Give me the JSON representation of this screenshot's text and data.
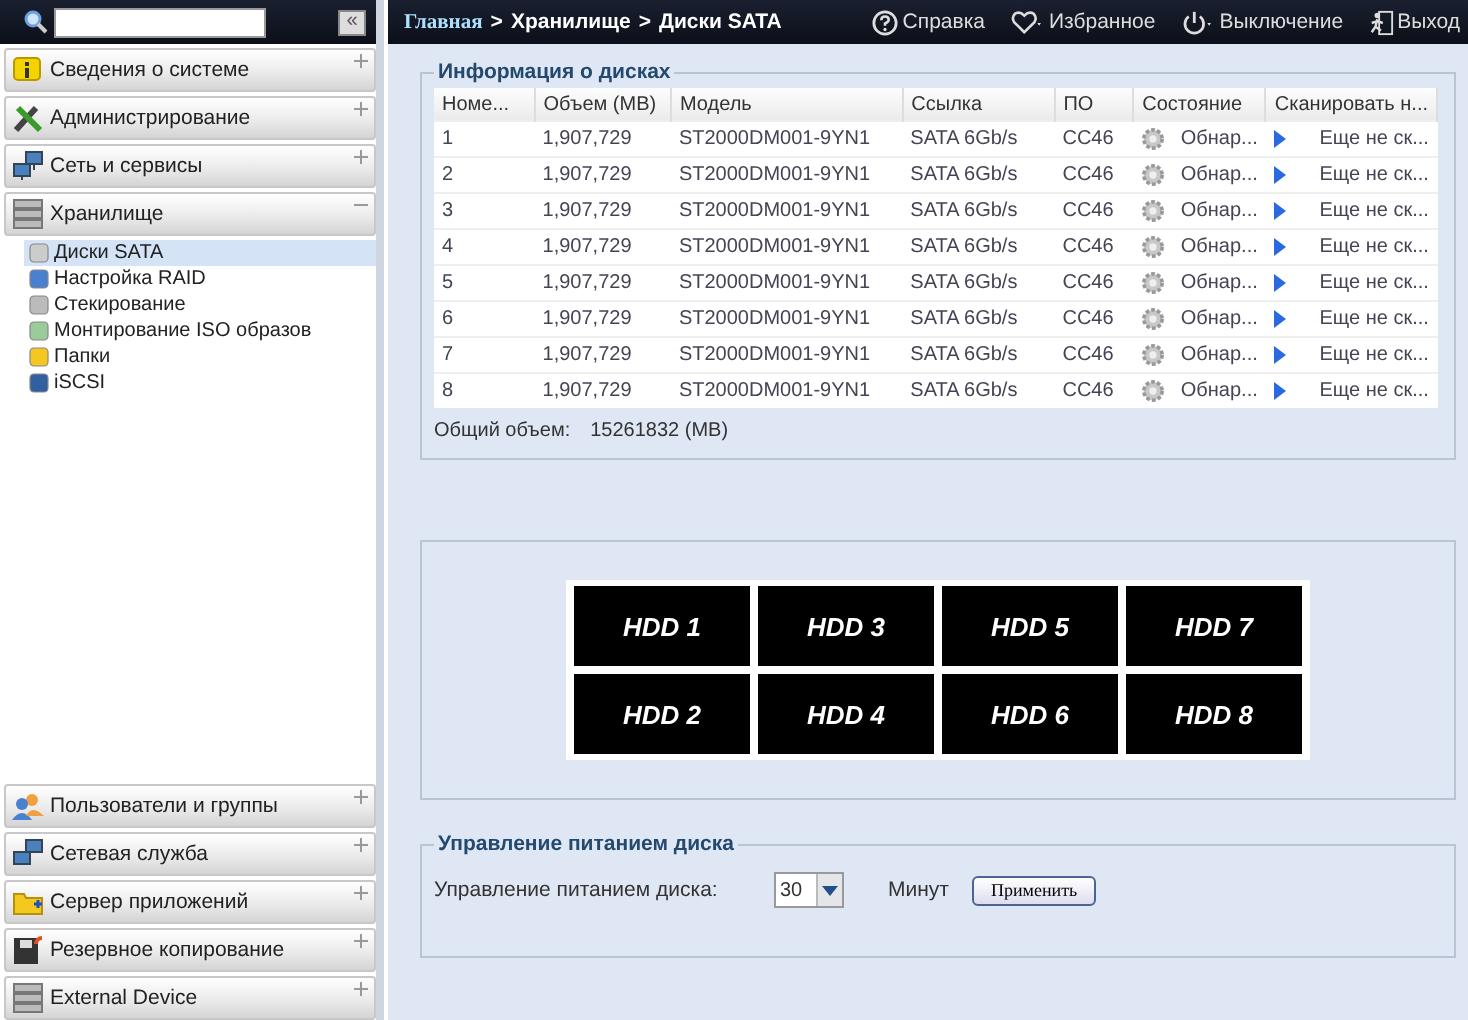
{
  "sidebar": {
    "collapse_button": "«",
    "sections": [
      {
        "label": "Сведения о системе",
        "expanded": false
      },
      {
        "label": "Администрирование",
        "expanded": false
      },
      {
        "label": "Сеть и сервисы",
        "expanded": false
      },
      {
        "label": "Хранилище",
        "expanded": true,
        "children": [
          {
            "label": "Диски SATA",
            "selected": true
          },
          {
            "label": "Настройка RAID",
            "selected": false
          },
          {
            "label": "Стекирование",
            "selected": false
          },
          {
            "label": "Монтирование ISO образов",
            "selected": false
          },
          {
            "label": "Папки",
            "selected": false
          },
          {
            "label": "iSCSI",
            "selected": false
          }
        ]
      }
    ],
    "bottom_sections": [
      {
        "label": "Пользователи и группы",
        "expanded": false
      },
      {
        "label": "Сетевая служба",
        "expanded": false
      },
      {
        "label": "Сервер приложений",
        "expanded": false
      },
      {
        "label": "Резервное копирование",
        "expanded": false
      },
      {
        "label": "External Device",
        "expanded": false
      }
    ]
  },
  "header": {
    "breadcrumb": [
      {
        "label": "Главная",
        "kind": "link"
      },
      {
        "label": ">",
        "kind": "separator"
      },
      {
        "label": "Хранилище",
        "kind": "text"
      },
      {
        "label": ">",
        "kind": "separator"
      },
      {
        "label": "Диски SATA",
        "kind": "text"
      }
    ],
    "actions": [
      "Справка",
      "Избранное",
      "Выключение",
      "Выход"
    ]
  },
  "disk_info": {
    "title": "Информация о дисках",
    "columns": [
      "Номе...",
      "Объем (MB)",
      "Модель",
      "Ссылка",
      "ПО",
      "Состояние",
      "Сканировать н..."
    ],
    "rows": [
      [
        "1",
        "1,907,729",
        "ST2000DM001-9YN1",
        "SATA 6Gb/s",
        "CC46",
        "Обнар...",
        "Еще не ск..."
      ],
      [
        "2",
        "1,907,729",
        "ST2000DM001-9YN1",
        "SATA 6Gb/s",
        "CC46",
        "Обнар...",
        "Еще не ск..."
      ],
      [
        "3",
        "1,907,729",
        "ST2000DM001-9YN1",
        "SATA 6Gb/s",
        "CC46",
        "Обнар...",
        "Еще не ск..."
      ],
      [
        "4",
        "1,907,729",
        "ST2000DM001-9YN1",
        "SATA 6Gb/s",
        "CC46",
        "Обнар...",
        "Еще не ск..."
      ],
      [
        "5",
        "1,907,729",
        "ST2000DM001-9YN1",
        "SATA 6Gb/s",
        "CC46",
        "Обнар...",
        "Еще не ск..."
      ],
      [
        "6",
        "1,907,729",
        "ST2000DM001-9YN1",
        "SATA 6Gb/s",
        "CC46",
        "Обнар...",
        "Еще не ск..."
      ],
      [
        "7",
        "1,907,729",
        "ST2000DM001-9YN1",
        "SATA 6Gb/s",
        "CC46",
        "Обнар...",
        "Еще не ск..."
      ],
      [
        "8",
        "1,907,729",
        "ST2000DM001-9YN1",
        "SATA 6Gb/s",
        "CC46",
        "Обнар...",
        "Еще не ск..."
      ]
    ],
    "total_label": "Общий объем:",
    "total_value": "15261832 (MB)"
  },
  "bays": [
    "HDD 1",
    "HDD 2",
    "HDD 3",
    "HDD 4",
    "HDD 5",
    "HDD 6",
    "HDD 7",
    "HDD 8"
  ],
  "power": {
    "title": "Управление питанием диска",
    "label": "Управление питанием диска:",
    "value": "30",
    "unit": "Минут",
    "apply": "Применить"
  }
}
